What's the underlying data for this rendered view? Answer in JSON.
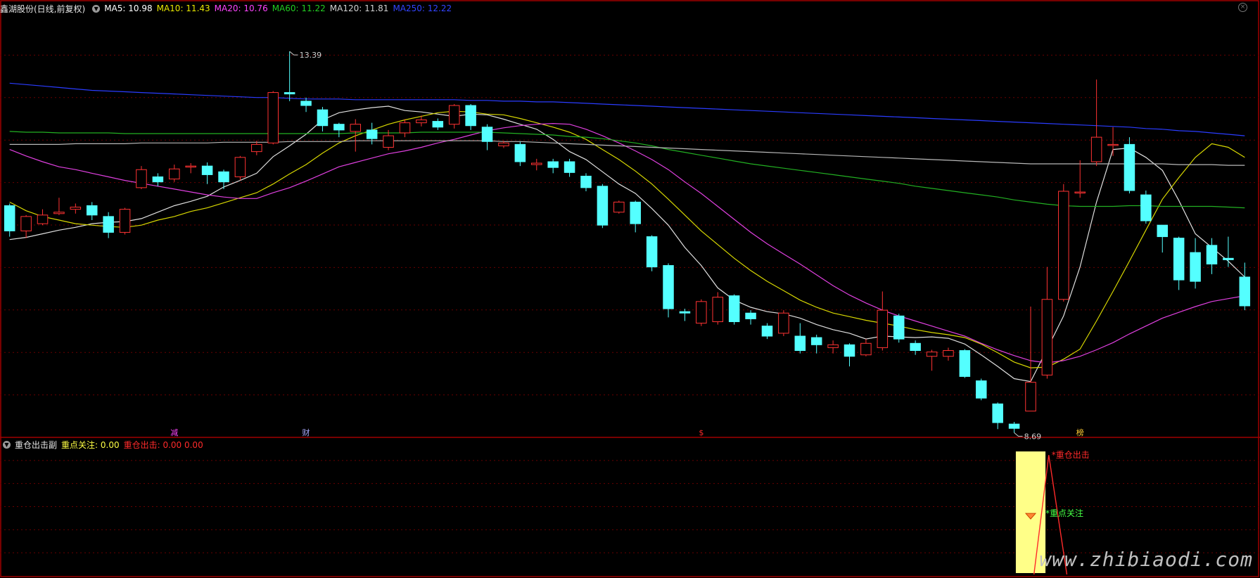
{
  "title": "鑫湖股份(日线,前复权)",
  "ma_legend": [
    {
      "label": "MA5: 10.98",
      "color": "#ffffff"
    },
    {
      "label": "MA10: 11.43",
      "color": "#e8e800"
    },
    {
      "label": "MA20: 10.76",
      "color": "#ff44ff"
    },
    {
      "label": "MA60: 11.22",
      "color": "#22cc22"
    },
    {
      "label": "MA120: 11.81",
      "color": "#d0d0d0"
    },
    {
      "label": "MA250: 12.22",
      "color": "#3344ff"
    }
  ],
  "sub_legend": {
    "title": "重仓出击副",
    "items": [
      {
        "label": "重点关注: 0.00",
        "color": "#ffff44"
      },
      {
        "label": "重仓出击: 0.00  0.00",
        "color": "#ff2a2a"
      }
    ]
  },
  "colors": {
    "up": "#ff3333",
    "down": "#54ffff",
    "grid": "#6a0000",
    "border": "#a00000"
  },
  "chart_data": {
    "type": "candlestick",
    "price_range": [
      8.25,
      13.85
    ],
    "high_label": "13.39",
    "low_label": "8.69",
    "candles": [
      [
        11.25,
        10.9,
        11.28,
        10.82
      ],
      [
        10.9,
        11.1,
        11.12,
        10.8
      ],
      [
        11.0,
        11.12,
        11.2,
        10.98
      ],
      [
        11.14,
        11.16,
        11.36,
        11.12
      ],
      [
        11.2,
        11.23,
        11.28,
        11.14
      ],
      [
        11.25,
        11.12,
        11.3,
        11.05
      ],
      [
        11.1,
        10.88,
        11.16,
        10.8
      ],
      [
        10.88,
        11.2,
        11.22,
        10.85
      ],
      [
        11.5,
        11.75,
        11.8,
        11.48
      ],
      [
        11.65,
        11.58,
        11.7,
        11.52
      ],
      [
        11.62,
        11.76,
        11.82,
        11.58
      ],
      [
        11.8,
        11.8,
        11.84,
        11.7
      ],
      [
        11.8,
        11.68,
        11.85,
        11.55
      ],
      [
        11.72,
        11.58,
        11.75,
        11.48
      ],
      [
        11.65,
        11.92,
        11.94,
        11.6
      ],
      [
        12.0,
        12.1,
        12.15,
        11.95
      ],
      [
        12.12,
        12.82,
        12.84,
        12.1
      ],
      [
        12.82,
        12.8,
        13.39,
        12.7
      ],
      [
        12.7,
        12.64,
        12.75,
        12.55
      ],
      [
        12.58,
        12.36,
        12.62,
        12.28
      ],
      [
        12.38,
        12.3,
        12.4,
        12.2
      ],
      [
        12.28,
        12.38,
        12.45,
        12.0
      ],
      [
        12.3,
        12.18,
        12.4,
        12.1
      ],
      [
        12.06,
        12.22,
        12.3,
        12.02
      ],
      [
        12.26,
        12.4,
        12.45,
        12.2
      ],
      [
        12.4,
        12.44,
        12.5,
        12.35
      ],
      [
        12.42,
        12.34,
        12.46,
        12.3
      ],
      [
        12.38,
        12.64,
        12.66,
        12.32
      ],
      [
        12.64,
        12.36,
        12.66,
        12.3
      ],
      [
        12.34,
        12.14,
        12.38,
        12.02
      ],
      [
        12.08,
        12.12,
        12.15,
        12.05
      ],
      [
        12.1,
        11.86,
        12.14,
        11.8
      ],
      [
        11.82,
        11.84,
        11.9,
        11.74
      ],
      [
        11.86,
        11.78,
        11.9,
        11.7
      ],
      [
        11.86,
        11.71,
        11.9,
        11.65
      ],
      [
        11.66,
        11.5,
        11.7,
        11.45
      ],
      [
        11.52,
        10.98,
        11.55,
        10.94
      ],
      [
        11.16,
        11.3,
        11.32,
        11.14
      ],
      [
        11.3,
        11.0,
        11.32,
        10.88
      ],
      [
        10.82,
        10.4,
        10.84,
        10.34
      ],
      [
        10.42,
        9.82,
        10.45,
        9.7
      ],
      [
        9.78,
        9.76,
        9.82,
        9.65
      ],
      [
        9.62,
        9.92,
        9.95,
        9.58
      ],
      [
        9.64,
        9.98,
        10.05,
        9.6
      ],
      [
        10.0,
        9.64,
        10.02,
        9.6
      ],
      [
        9.76,
        9.68,
        9.8,
        9.6
      ],
      [
        9.58,
        9.44,
        9.62,
        9.4
      ],
      [
        9.48,
        9.76,
        9.8,
        9.44
      ],
      [
        9.44,
        9.24,
        9.62,
        9.2
      ],
      [
        9.42,
        9.32,
        9.46,
        9.2
      ],
      [
        9.28,
        9.32,
        9.38,
        9.2
      ],
      [
        9.32,
        9.16,
        9.34,
        9.02
      ],
      [
        9.18,
        9.34,
        9.4,
        9.16
      ],
      [
        9.28,
        9.8,
        10.06,
        9.24
      ],
      [
        9.72,
        9.4,
        9.75,
        9.35
      ],
      [
        9.34,
        9.24,
        9.38,
        9.18
      ],
      [
        9.16,
        9.22,
        9.25,
        8.96
      ],
      [
        9.16,
        9.24,
        9.28,
        9.1
      ],
      [
        9.24,
        8.88,
        9.26,
        8.86
      ],
      [
        8.82,
        8.58,
        8.85,
        8.55
      ],
      [
        8.5,
        8.24,
        8.52,
        8.15
      ],
      [
        8.22,
        8.16,
        8.25,
        8.1
      ],
      [
        8.4,
        8.8,
        9.85,
        8.69
      ],
      [
        8.9,
        9.95,
        10.4,
        8.85
      ],
      [
        9.95,
        11.45,
        11.55,
        9.92
      ],
      [
        11.44,
        11.44,
        11.88,
        11.36
      ],
      [
        11.86,
        12.2,
        13.0,
        11.8
      ],
      [
        12.1,
        12.1,
        12.34,
        11.94
      ],
      [
        12.1,
        11.46,
        12.2,
        11.42
      ],
      [
        11.4,
        11.04,
        11.46,
        11.0
      ],
      [
        10.98,
        10.82,
        10.98,
        10.6
      ],
      [
        10.8,
        10.22,
        10.82,
        10.08
      ],
      [
        10.6,
        10.2,
        10.8,
        10.1
      ],
      [
        10.7,
        10.44,
        10.8,
        10.3
      ],
      [
        10.52,
        10.5,
        10.82,
        10.4
      ],
      [
        10.26,
        9.86,
        10.46,
        9.8
      ]
    ],
    "ma_series": [
      {
        "color": "#e0e0e0",
        "values": [
          10.78,
          10.81,
          10.86,
          10.91,
          10.95,
          11.0,
          11.02,
          11.03,
          11.07,
          11.16,
          11.25,
          11.31,
          11.38,
          11.51,
          11.6,
          11.7,
          11.93,
          12.08,
          12.24,
          12.44,
          12.54,
          12.58,
          12.61,
          12.63,
          12.57,
          12.55,
          12.52,
          12.49,
          12.52,
          12.51,
          12.45,
          12.38,
          12.31,
          12.17,
          12.0,
          11.89,
          11.72,
          11.55,
          11.42,
          11.21,
          10.98,
          10.67,
          10.42,
          10.11,
          9.94,
          9.84,
          9.78,
          9.75,
          9.69,
          9.6,
          9.53,
          9.48,
          9.4,
          9.44,
          9.43,
          9.42,
          9.43,
          9.41,
          9.33,
          9.18,
          9.02,
          8.85,
          8.81,
          9.26,
          9.72,
          10.4,
          11.3,
          12.03,
          12.05,
          11.92,
          11.74,
          11.32,
          10.86,
          10.67,
          10.48,
          10.26
        ]
      },
      {
        "color": "#d8d800",
        "values": [
          11.3,
          11.18,
          11.1,
          11.05,
          11.0,
          10.98,
          10.96,
          10.95,
          10.98,
          11.05,
          11.1,
          11.17,
          11.22,
          11.29,
          11.36,
          11.43,
          11.55,
          11.69,
          11.82,
          11.98,
          12.12,
          12.22,
          12.3,
          12.38,
          12.44,
          12.49,
          12.54,
          12.56,
          12.55,
          12.52,
          12.51,
          12.46,
          12.4,
          12.34,
          12.27,
          12.17,
          12.03,
          11.89,
          11.73,
          11.55,
          11.34,
          11.12,
          10.9,
          10.71,
          10.52,
          10.35,
          10.2,
          10.07,
          9.94,
          9.84,
          9.76,
          9.71,
          9.66,
          9.62,
          9.58,
          9.53,
          9.49,
          9.46,
          9.42,
          9.33,
          9.21,
          9.08,
          9.0,
          9.01,
          9.12,
          9.26,
          9.65,
          10.06,
          10.48,
          10.91,
          11.34,
          11.64,
          11.92,
          12.11,
          12.06,
          11.92
        ]
      },
      {
        "color": "#e040e0",
        "values": [
          12.03,
          11.94,
          11.86,
          11.79,
          11.75,
          11.7,
          11.65,
          11.6,
          11.56,
          11.52,
          11.48,
          11.44,
          11.4,
          11.37,
          11.35,
          11.35,
          11.43,
          11.5,
          11.59,
          11.69,
          11.79,
          11.85,
          11.91,
          11.97,
          12.01,
          12.06,
          12.12,
          12.17,
          12.23,
          12.29,
          12.33,
          12.36,
          12.38,
          12.39,
          12.38,
          12.31,
          12.22,
          12.12,
          12.01,
          11.89,
          11.75,
          11.58,
          11.42,
          11.24,
          11.06,
          10.88,
          10.72,
          10.58,
          10.44,
          10.29,
          10.14,
          10.01,
          9.9,
          9.8,
          9.72,
          9.65,
          9.58,
          9.51,
          9.44,
          9.34,
          9.25,
          9.17,
          9.1,
          9.07,
          9.1,
          9.16,
          9.25,
          9.35,
          9.47,
          9.58,
          9.69,
          9.77,
          9.85,
          9.92,
          9.96,
          10.0
        ]
      },
      {
        "color": "#22b022",
        "values": [
          12.28,
          12.27,
          12.27,
          12.26,
          12.26,
          12.26,
          12.26,
          12.25,
          12.25,
          12.25,
          12.25,
          12.25,
          12.25,
          12.25,
          12.25,
          12.25,
          12.25,
          12.25,
          12.25,
          12.25,
          12.25,
          12.26,
          12.26,
          12.26,
          12.26,
          12.27,
          12.27,
          12.27,
          12.27,
          12.27,
          12.26,
          12.25,
          12.24,
          12.23,
          12.21,
          12.2,
          12.18,
          12.15,
          12.12,
          12.08,
          12.03,
          11.99,
          11.95,
          11.91,
          11.87,
          11.83,
          11.8,
          11.77,
          11.74,
          11.71,
          11.68,
          11.65,
          11.62,
          11.59,
          11.56,
          11.52,
          11.49,
          11.46,
          11.43,
          11.4,
          11.37,
          11.33,
          11.3,
          11.27,
          11.25,
          11.24,
          11.24,
          11.24,
          11.25,
          11.25,
          11.24,
          11.24,
          11.24,
          11.24,
          11.23,
          11.22
        ]
      },
      {
        "color": "#b8b8b8",
        "values": [
          12.1,
          12.1,
          12.1,
          12.1,
          12.11,
          12.11,
          12.11,
          12.11,
          12.12,
          12.12,
          12.12,
          12.12,
          12.12,
          12.13,
          12.13,
          12.13,
          12.13,
          12.14,
          12.14,
          12.14,
          12.14,
          12.15,
          12.15,
          12.15,
          12.15,
          12.15,
          12.15,
          12.15,
          12.15,
          12.15,
          12.14,
          12.14,
          12.13,
          12.12,
          12.11,
          12.1,
          12.09,
          12.08,
          12.07,
          12.06,
          12.05,
          12.04,
          12.03,
          12.02,
          12.01,
          12.0,
          11.99,
          11.98,
          11.97,
          11.96,
          11.95,
          11.94,
          11.93,
          11.92,
          11.91,
          11.9,
          11.89,
          11.88,
          11.87,
          11.86,
          11.85,
          11.84,
          11.83,
          11.83,
          11.83,
          11.83,
          11.83,
          11.83,
          11.83,
          11.83,
          11.83,
          11.82,
          11.82,
          11.82,
          11.81,
          11.81
        ]
      },
      {
        "color": "#2a3cff",
        "values": [
          12.95,
          12.93,
          12.91,
          12.89,
          12.87,
          12.85,
          12.84,
          12.83,
          12.82,
          12.81,
          12.8,
          12.79,
          12.78,
          12.77,
          12.76,
          12.75,
          12.75,
          12.74,
          12.73,
          12.73,
          12.73,
          12.72,
          12.72,
          12.72,
          12.72,
          12.72,
          12.72,
          12.72,
          12.71,
          12.71,
          12.7,
          12.7,
          12.69,
          12.69,
          12.68,
          12.67,
          12.66,
          12.65,
          12.64,
          12.63,
          12.62,
          12.61,
          12.6,
          12.59,
          12.58,
          12.57,
          12.56,
          12.55,
          12.54,
          12.53,
          12.52,
          12.51,
          12.5,
          12.49,
          12.48,
          12.47,
          12.46,
          12.45,
          12.44,
          12.43,
          12.42,
          12.41,
          12.4,
          12.39,
          12.38,
          12.37,
          12.36,
          12.35,
          12.34,
          12.32,
          12.31,
          12.29,
          12.28,
          12.26,
          12.24,
          12.22
        ]
      }
    ],
    "markers": [
      {
        "text": "减",
        "index": 10,
        "color": "#ff44ff"
      },
      {
        "text": "财",
        "index": 18,
        "color": "#aaaaff"
      },
      {
        "text": "$",
        "index": 42,
        "color": "#ff2a2a"
      },
      {
        "text": "榜",
        "index": 65,
        "color": "#ffcc33"
      }
    ],
    "indicator": {
      "highlight_index": 62,
      "focus_label": "重点关注",
      "strike_label": "重仓出击",
      "focus_value": 5,
      "strike_value": 10,
      "y_range": [
        0,
        11
      ]
    }
  },
  "watermark": "www.zhibiaodi.com"
}
